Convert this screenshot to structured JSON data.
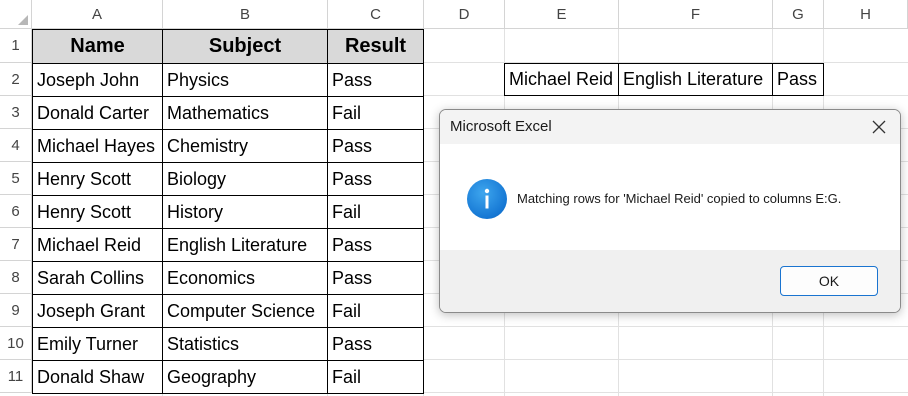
{
  "columns": [
    "A",
    "B",
    "C",
    "D",
    "E",
    "F",
    "G",
    "H"
  ],
  "rows": [
    "1",
    "2",
    "3",
    "4",
    "5",
    "6",
    "7",
    "8",
    "9",
    "10",
    "11"
  ],
  "table": {
    "headers": [
      "Name",
      "Subject",
      "Result"
    ],
    "data": [
      [
        "Joseph John",
        "Physics",
        "Pass"
      ],
      [
        "Donald Carter",
        "Mathematics",
        "Fail"
      ],
      [
        "Michael Hayes",
        "Chemistry",
        "Pass"
      ],
      [
        "Henry Scott",
        "Biology",
        "Pass"
      ],
      [
        "Henry Scott",
        "History",
        "Fail"
      ],
      [
        "Michael Reid",
        "English Literature",
        "Pass"
      ],
      [
        "Sarah Collins",
        "Economics",
        "Pass"
      ],
      [
        "Joseph Grant",
        "Computer Science",
        "Fail"
      ],
      [
        "Emily Turner",
        "Statistics",
        "Pass"
      ],
      [
        "Donald Shaw",
        "Geography",
        "Fail"
      ]
    ]
  },
  "result_row": [
    "Michael Reid",
    "English Literature",
    "Pass"
  ],
  "dialog": {
    "title": "Microsoft Excel",
    "message": "Matching rows for 'Michael Reid' copied to columns E:G.",
    "ok_label": "OK",
    "icon": "info-icon",
    "close_icon": "close-icon"
  },
  "colors": {
    "header_fill": "#d9d9d9",
    "accent": "#1a74d0"
  }
}
